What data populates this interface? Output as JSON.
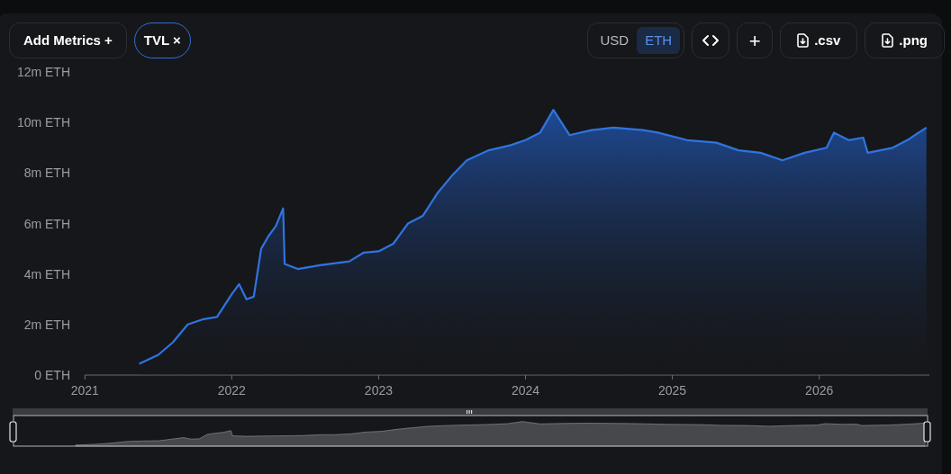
{
  "toolbar": {
    "add_metrics": {
      "label": "Add Metrics",
      "icon": "+"
    },
    "metrics": [
      {
        "label": "TVL",
        "remove_icon": "×"
      }
    ],
    "currency": [
      {
        "label": "USD",
        "selected": false
      },
      {
        "label": "ETH",
        "selected": true
      }
    ],
    "actions": [
      {
        "kind": "embed"
      },
      {
        "kind": "add",
        "label": "+"
      },
      {
        "kind": "download",
        "label": ".csv"
      },
      {
        "kind": "download",
        "label": ".png"
      }
    ]
  },
  "chart_data": {
    "type": "area",
    "xlim": [
      2020.98,
      2026.75
    ],
    "ylim": [
      0,
      12
    ],
    "xticks": [
      {
        "value": 2021,
        "label": "2021"
      },
      {
        "value": 2022,
        "label": "2022"
      },
      {
        "value": 2023,
        "label": "2023"
      },
      {
        "value": 2024,
        "label": "2024"
      },
      {
        "value": 2025,
        "label": "2025"
      },
      {
        "value": 2026,
        "label": "2026"
      }
    ],
    "yticks": [
      {
        "value": 0,
        "label": "0 ETH"
      },
      {
        "value": 2,
        "label": "2m ETH"
      },
      {
        "value": 4,
        "label": "4m ETH"
      },
      {
        "value": 6,
        "label": "6m ETH"
      },
      {
        "value": 8,
        "label": "8m ETH"
      },
      {
        "value": 10,
        "label": "10m ETH"
      },
      {
        "value": 12,
        "label": "12m ETH"
      }
    ],
    "x": [
      2021.37,
      2021.5,
      2021.6,
      2021.7,
      2021.8,
      2021.9,
      2022.0,
      2022.05,
      2022.1,
      2022.15,
      2022.2,
      2022.25,
      2022.3,
      2022.35,
      2022.36,
      2022.45,
      2022.6,
      2022.8,
      2022.9,
      2023.0,
      2023.1,
      2023.2,
      2023.3,
      2023.4,
      2023.5,
      2023.6,
      2023.75,
      2023.9,
      2024.0,
      2024.1,
      2024.19,
      2024.3,
      2024.45,
      2024.6,
      2024.8,
      2024.9,
      2025.1,
      2025.3,
      2025.45,
      2025.6,
      2025.75,
      2025.9,
      2026.05,
      2026.1,
      2026.2,
      2026.3,
      2026.33,
      2026.5,
      2026.6,
      2026.73
    ],
    "series": [
      {
        "color": "#2f74e0",
        "values": [
          0.45,
          0.8,
          1.3,
          2.0,
          2.2,
          2.3,
          3.2,
          3.6,
          3.0,
          3.1,
          5.0,
          5.5,
          5.9,
          6.6,
          4.4,
          4.2,
          4.35,
          4.5,
          4.85,
          4.9,
          5.2,
          6.0,
          6.3,
          7.2,
          7.9,
          8.5,
          8.9,
          9.1,
          9.3,
          9.6,
          10.5,
          9.5,
          9.7,
          9.8,
          9.7,
          9.6,
          9.3,
          9.2,
          8.9,
          8.8,
          8.5,
          8.8,
          9.0,
          9.6,
          9.3,
          9.4,
          8.8,
          9.0,
          9.3,
          9.8
        ]
      }
    ]
  }
}
